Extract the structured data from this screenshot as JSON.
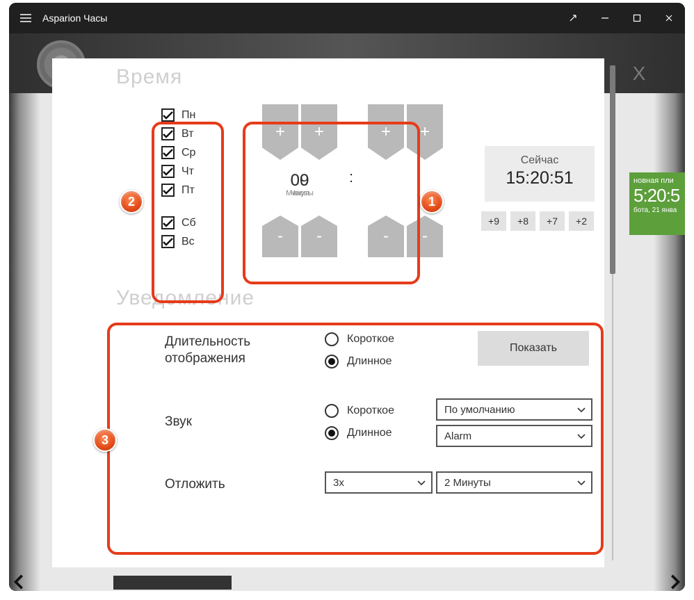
{
  "app": {
    "title": "Asparion Часы"
  },
  "modal": {
    "close_label": "X",
    "sections": {
      "time": "Время",
      "notification": "Уведомление"
    },
    "days": {
      "weekday_items": [
        {
          "label": "Пн",
          "checked": true
        },
        {
          "label": "Вт",
          "checked": true
        },
        {
          "label": "Ср",
          "checked": true
        },
        {
          "label": "Чт",
          "checked": true
        },
        {
          "label": "Пт",
          "checked": true
        }
      ],
      "weekend_items": [
        {
          "label": "Сб",
          "checked": true
        },
        {
          "label": "Вс",
          "checked": true
        }
      ]
    },
    "time_picker": {
      "hours_value": "09",
      "hours_label": "Часы",
      "minutes_value": "00",
      "minutes_label": "Минуты",
      "colon": ":",
      "plus": "+",
      "minus": "-"
    },
    "now": {
      "label": "Сейчас",
      "value": "15:20:51"
    },
    "quick_offsets": [
      "+9",
      "+8",
      "+7",
      "+2"
    ],
    "notification": {
      "duration_label": "Длительность\nотображения",
      "duration_options": {
        "short": "Короткое",
        "long": "Длинное",
        "selected": "long"
      },
      "show_button": "Показать",
      "sound_label": "Звук",
      "sound_options": {
        "short": "Короткое",
        "long": "Длинное",
        "selected": "long"
      },
      "sound_short_select": "По умолчанию",
      "sound_long_select": "Alarm",
      "snooze_label": "Отложить",
      "snooze_count_select": "3x",
      "snooze_interval_select": "2 Минуты"
    }
  },
  "background_widget": {
    "line1": "новная пли",
    "time": "5:20:5",
    "date": "бота, 21 янва"
  },
  "annotations": {
    "b1": "1",
    "b2": "2",
    "b3": "3"
  }
}
